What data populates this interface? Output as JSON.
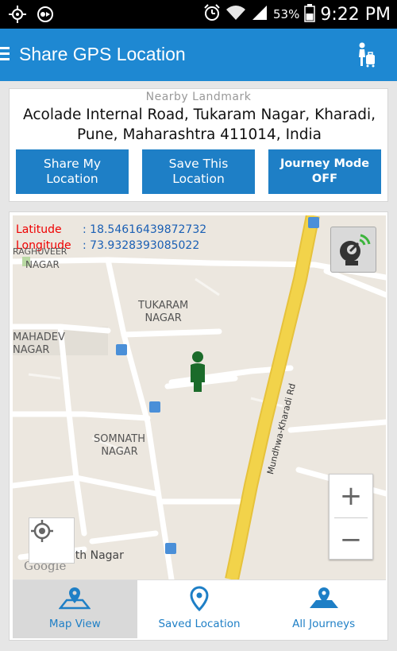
{
  "status_bar": {
    "battery_percent": "53%",
    "time": "9:22 PM"
  },
  "app_bar": {
    "title": "Share GPS Location"
  },
  "landmark": {
    "title": "Nearby Landmark",
    "address_line1": "Acolade Internal Road, Tukaram Nagar, Kharadi,",
    "address_line2": "Pune, Maharashtra 411014, India"
  },
  "actions": {
    "share_line1": "Share My",
    "share_line2": "Location",
    "save_line1": "Save This",
    "save_line2": "Location",
    "journey_line1": "Journey Mode",
    "journey_line2": "OFF"
  },
  "map": {
    "latitude_label": "Latitude",
    "latitude_value": ": 18.54616439872732",
    "longitude_label": "Longitude",
    "longitude_value": ": 73.9328393085022",
    "labels": {
      "raghuveer": "RAGHUVEER",
      "raghuveer_nagar": "NAGAR",
      "tukaram": "TUKARAM",
      "tukaram_nagar": "NAGAR",
      "mahadev": "MAHADEV",
      "mahadev_nagar": "NAGAR",
      "somnath": "SOMNATH",
      "somnath_nagar": "NAGAR",
      "road": "Mundhwa-Kharadi Rd",
      "bottom": "Sainath Nagar"
    },
    "zoom_in": "+",
    "zoom_out": "−",
    "colors": {
      "major_road": "#f2d34a",
      "minor_road": "#ffffff",
      "pin": "#1b6b2a"
    }
  },
  "bottom_nav": {
    "map_view": "Map View",
    "saved_location": "Saved Location",
    "all_journeys": "All Journeys"
  },
  "colors": {
    "accent": "#1e88d2",
    "button": "#1e7fc6",
    "latitude_label": "#e00000",
    "coordinate_value": "#1a5fb4"
  }
}
